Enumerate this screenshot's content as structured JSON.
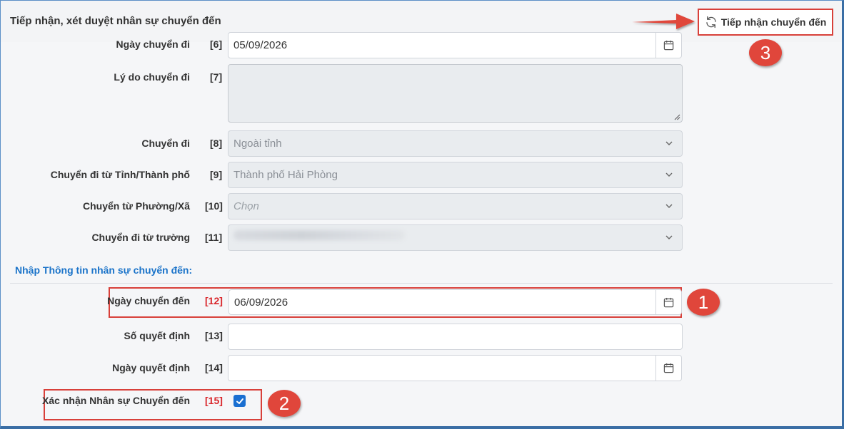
{
  "header": {
    "title": "Tiếp nhận, xét duyệt nhân sự chuyển đến",
    "action_button": "Tiếp nhận chuyển đến",
    "action_icon": "refresh-icon"
  },
  "fields": {
    "ngay_chuyen_di": {
      "label": "Ngày chuyển đi",
      "num": "[6]",
      "value": "05/09/2026"
    },
    "ly_do": {
      "label": "Lý do chuyển đi",
      "num": "[7]",
      "value": ""
    },
    "chuyen_di": {
      "label": "Chuyển đi",
      "num": "[8]",
      "value": "Ngoài tỉnh"
    },
    "tinh_tp": {
      "label": "Chuyển đi từ Tỉnh/Thành phố",
      "num": "[9]",
      "value": "Thành phố Hải Phòng"
    },
    "phuong_xa": {
      "label": "Chuyển từ Phường/Xã",
      "num": "[10]",
      "placeholder": "Chọn"
    },
    "truong": {
      "label": "Chuyển đi từ trường",
      "num": "[11]"
    }
  },
  "section": {
    "title": "Nhập Thông tin nhân sự chuyển đến:"
  },
  "incoming": {
    "ngay_chuyen_den": {
      "label": "Ngày chuyển đến",
      "num": "[12]",
      "value": "06/09/2026"
    },
    "so_quyet_dinh": {
      "label": "Số quyết định",
      "num": "[13]",
      "value": ""
    },
    "ngay_quyet_dinh": {
      "label": "Ngày quyết định",
      "num": "[14]",
      "value": ""
    },
    "xac_nhan": {
      "label": "Xác nhận Nhân sự Chuyển đến",
      "num": "[15]",
      "checked": true
    }
  },
  "badges": {
    "b1": "1",
    "b2": "2",
    "b3": "3"
  },
  "colors": {
    "accent": "#d8403a",
    "link": "#1a73c9",
    "checkbox": "#1a6fd1"
  }
}
